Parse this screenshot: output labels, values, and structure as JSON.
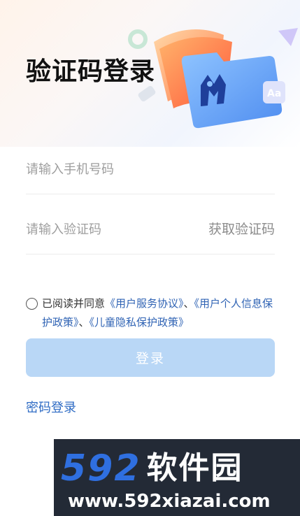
{
  "header": {
    "title": "验证码登录"
  },
  "form": {
    "phone_placeholder": "请输入手机号码",
    "code_placeholder": "请输入验证码",
    "get_code_label": "获取验证码"
  },
  "agreement": {
    "prefix": "已阅读并同意",
    "user_service": "《用户服务协议》",
    "sep1": "、",
    "personal_info": "《用户个人信息保护政策》",
    "sep2": "、",
    "child_privacy": "《儿童隐私保护政策》"
  },
  "actions": {
    "login_label": "登录",
    "password_login_label": "密码登录"
  },
  "watermark": {
    "number": "592",
    "name": "软件园",
    "url": "www.592xiazai.com"
  },
  "colors": {
    "accent": "#2e6bc4",
    "button_disabled": "#b9d7f6",
    "link": "#2f63b4"
  },
  "icons": {
    "illustration": "folder-with-m-logo-icon",
    "agreement_toggle": "radio-icon"
  }
}
